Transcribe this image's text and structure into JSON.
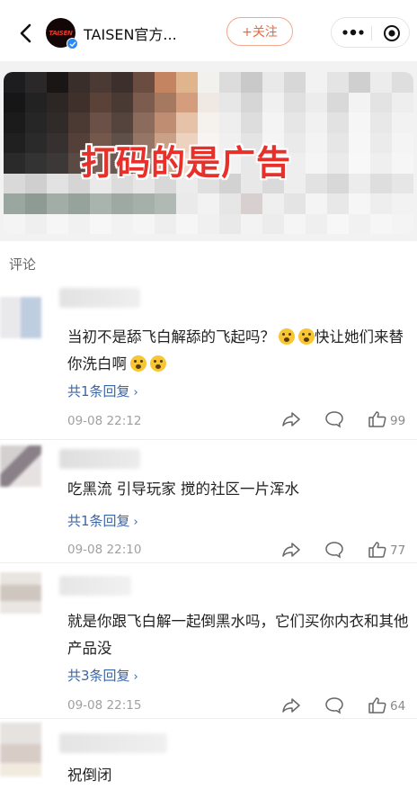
{
  "header": {
    "account_name": "TAISEN官方...",
    "logo_text": "TAISEN",
    "follow_label": "+关注"
  },
  "banner": {
    "overlay_text": "打码的是广告"
  },
  "comments_section": {
    "title": "评论"
  },
  "comments": [
    {
      "text": "当初不是舔飞白解舔的飞起吗？",
      "text2": "快让她们来替你洗白啊",
      "emoji_name": "fearful-face-emoji",
      "replies": "共1条回复",
      "time": "09-08 22:12",
      "likes": "99"
    },
    {
      "text": "吃黑流 引导玩家 搅的社区一片浑水",
      "replies": "共1条回复",
      "time": "09-08 22:10",
      "likes": "77"
    },
    {
      "text": "就是你跟飞白解一起倒黑水吗，它们买你内衣和其他产品没",
      "replies": "共3条回复",
      "time": "09-08 22:15",
      "likes": "64"
    },
    {
      "text": "祝倒闭"
    }
  ],
  "icons": {
    "back": "back-arrow-icon",
    "more": "more-dots-icon",
    "close": "target-circle-icon",
    "share": "share-arrow-icon",
    "comment": "comment-bubble-icon",
    "like": "thumbs-up-icon",
    "verified": "verified-badge-icon"
  },
  "colors": {
    "accent_orange": "#e8683c",
    "link_blue": "#3a66a8",
    "banner_red": "#e8302b",
    "verified_blue": "#2b8af7"
  }
}
